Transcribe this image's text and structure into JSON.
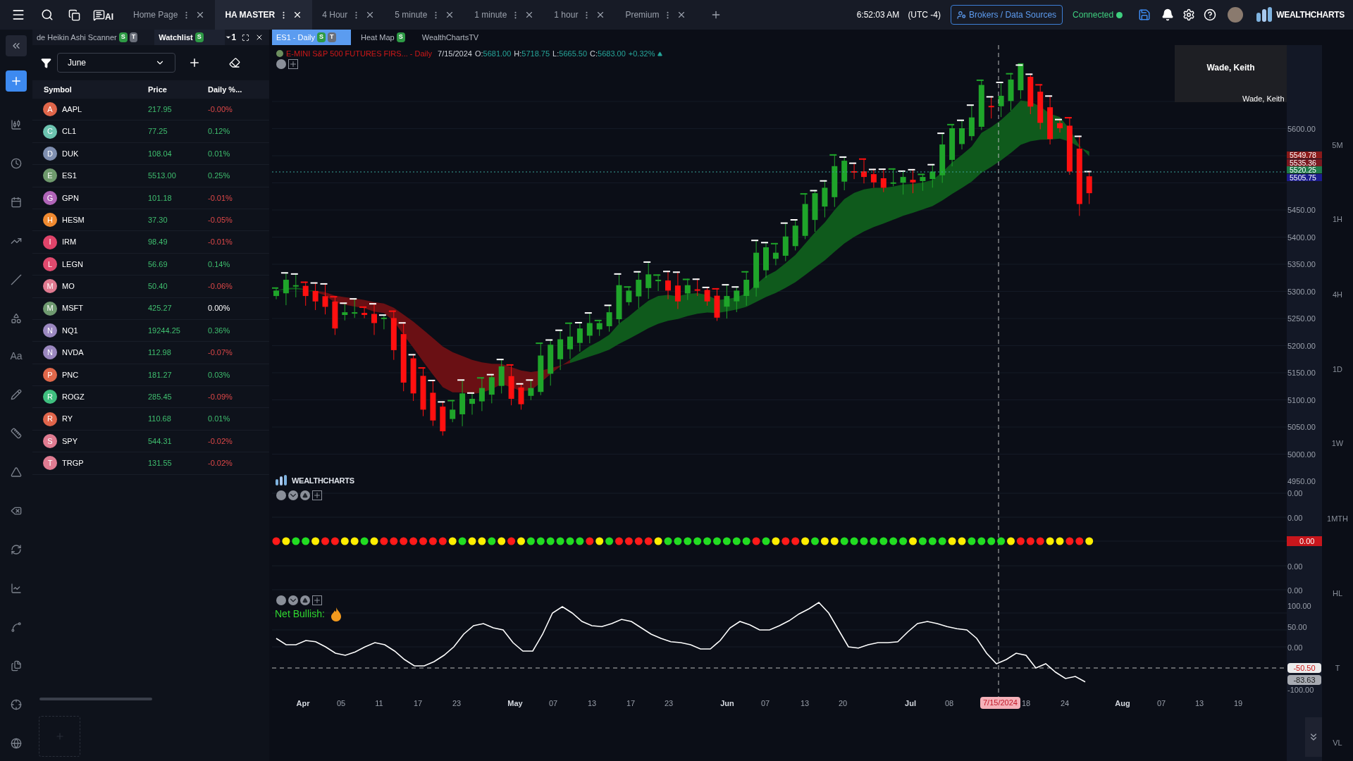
{
  "top_bar": {
    "ai_label": "AI",
    "tabs": [
      {
        "label": "Home Page",
        "selected": false
      },
      {
        "label": "HA MASTER",
        "selected": true
      },
      {
        "label": "4 Hour",
        "selected": false
      },
      {
        "label": "5 minute",
        "selected": false
      },
      {
        "label": "1 minute",
        "selected": false
      },
      {
        "label": "1 hour",
        "selected": false
      },
      {
        "label": "Premium",
        "selected": false
      }
    ],
    "clock": "6:52:03 AM",
    "timezone": "(UTC -4)",
    "brokers_button": "Brokers / Data Sources",
    "connection": {
      "label": "Connected",
      "on": true
    },
    "logo": "WEALTHCHARTS"
  },
  "left_rail": {
    "text_tool": "Aa"
  },
  "left_panel": {
    "tabs": [
      {
        "label": "de Heikin Ashi Scanner",
        "badges": [
          "S",
          "T"
        ],
        "selected": false
      },
      {
        "label": "Watchlist",
        "badges": [
          "S"
        ],
        "selected": true
      }
    ],
    "layout_count": "1",
    "filter_select": "June",
    "table": {
      "columns": [
        "Symbol",
        "Price",
        "Daily %..."
      ],
      "rows": [
        {
          "letter": "A",
          "color": "#e0664a",
          "symbol": "AAPL",
          "price": "217.95",
          "change": "-0.00%",
          "kind": "down"
        },
        {
          "letter": "C",
          "color": "#6cc3b0",
          "symbol": "CL1",
          "price": "77.25",
          "change": "0.12%",
          "kind": "up"
        },
        {
          "letter": "D",
          "color": "#7f8fb0",
          "symbol": "DUK",
          "price": "108.04",
          "change": "0.01%",
          "kind": "up"
        },
        {
          "letter": "E",
          "color": "#6f9a6d",
          "symbol": "ES1",
          "price": "5513.00",
          "change": "0.25%",
          "kind": "up"
        },
        {
          "letter": "G",
          "color": "#b064b8",
          "symbol": "GPN",
          "price": "101.18",
          "change": "-0.01%",
          "kind": "down"
        },
        {
          "letter": "H",
          "color": "#f08a30",
          "symbol": "HESM",
          "price": "37.30",
          "change": "-0.05%",
          "kind": "down"
        },
        {
          "letter": "I",
          "color": "#e0446a",
          "symbol": "IRM",
          "price": "98.49",
          "change": "-0.01%",
          "kind": "down"
        },
        {
          "letter": "L",
          "color": "#e04a6e",
          "symbol": "LEGN",
          "price": "56.69",
          "change": "0.14%",
          "kind": "up"
        },
        {
          "letter": "M",
          "color": "#e07a90",
          "symbol": "MO",
          "price": "50.40",
          "change": "-0.06%",
          "kind": "down"
        },
        {
          "letter": "M",
          "color": "#6f9a70",
          "symbol": "MSFT",
          "price": "425.27",
          "change": "0.00%",
          "kind": "flat"
        },
        {
          "letter": "N",
          "color": "#9b88c0",
          "symbol": "NQ1",
          "price": "19244.25",
          "change": "0.36%",
          "kind": "up"
        },
        {
          "letter": "N",
          "color": "#9a87bf",
          "symbol": "NVDA",
          "price": "112.98",
          "change": "-0.07%",
          "kind": "down"
        },
        {
          "letter": "P",
          "color": "#e0684a",
          "symbol": "PNC",
          "price": "181.27",
          "change": "0.03%",
          "kind": "up"
        },
        {
          "letter": "R",
          "color": "#3fbf7f",
          "symbol": "ROGZ",
          "price": "285.45",
          "change": "-0.09%",
          "kind": "down"
        },
        {
          "letter": "R",
          "color": "#e0654b",
          "symbol": "RY",
          "price": "110.68",
          "change": "0.01%",
          "kind": "up"
        },
        {
          "letter": "S",
          "color": "#e07b91",
          "symbol": "SPY",
          "price": "544.31",
          "change": "-0.02%",
          "kind": "down"
        },
        {
          "letter": "T",
          "color": "#e07c92",
          "symbol": "TRGP",
          "price": "131.55",
          "change": "-0.02%",
          "kind": "down"
        }
      ]
    }
  },
  "chart": {
    "tabs": [
      {
        "label": "ES1 - Daily",
        "badges": [
          "S",
          "T"
        ],
        "selected": true
      },
      {
        "label": "Heat Map",
        "badges": [
          "S"
        ],
        "selected": false
      },
      {
        "label": "WealthChartsTV",
        "selected": false
      }
    ],
    "legend": {
      "title": "E-MINI S&P 500 FUTURES FIRS... - Daily",
      "date": "7/15/2024",
      "open_label": "O:",
      "open": "5681.00",
      "high_label": "H:",
      "high": "5718.75",
      "low_label": "L:",
      "low": "5665.50",
      "close_label": "C:",
      "close": "5683.00",
      "change": "+0.32%"
    },
    "pane_logo": "WEALTHCHARTS",
    "price_axis": [
      "5600.00",
      "5450.00",
      "5400.00",
      "5350.00",
      "5300.00",
      "5250.00",
      "5200.00",
      "5150.00",
      "5100.00",
      "5050.00",
      "5000.00",
      "4950.00"
    ],
    "price_tags": [
      {
        "text": "5549.78",
        "color": "#8b1a1a"
      },
      {
        "text": "5535.36",
        "color": "#7a1820"
      },
      {
        "text": "5520.25",
        "color": "#1f7a4a"
      },
      {
        "text": "5505.75",
        "color": "#1c1c8c"
      }
    ],
    "signal_axis": [
      "0.00",
      "0.00",
      "0.00",
      "0.00"
    ],
    "signal_tag": "0.00",
    "signal_dots": [
      {
        "color": "#ff1a1a"
      },
      {
        "color": "#ffee00"
      },
      {
        "color": "#22dd22"
      },
      {
        "color": "#22dd22"
      },
      {
        "color": "#ffee00"
      },
      {
        "color": "#ff1a1a"
      },
      {
        "color": "#ff1a1a"
      },
      {
        "color": "#ffee00"
      },
      {
        "color": "#ffee00"
      },
      {
        "color": "#22dd22"
      },
      {
        "color": "#ffee00"
      },
      {
        "color": "#ff1a1a"
      },
      {
        "color": "#ff1a1a"
      },
      {
        "color": "#ff1a1a"
      },
      {
        "color": "#ff1a1a"
      },
      {
        "color": "#ff1a1a"
      },
      {
        "color": "#ff1a1a"
      },
      {
        "color": "#ff1a1a"
      },
      {
        "color": "#ffee00"
      },
      {
        "color": "#22dd22"
      },
      {
        "color": "#ffee00"
      },
      {
        "color": "#ffee00"
      },
      {
        "color": "#22dd22"
      },
      {
        "color": "#ffee00"
      },
      {
        "color": "#ff1a1a"
      },
      {
        "color": "#ffee00"
      },
      {
        "color": "#22dd22"
      },
      {
        "color": "#22dd22"
      },
      {
        "color": "#22dd22"
      },
      {
        "color": "#22dd22"
      },
      {
        "color": "#22dd22"
      },
      {
        "color": "#22dd22"
      },
      {
        "color": "#ff1a1a"
      },
      {
        "color": "#ffee00"
      },
      {
        "color": "#22dd22"
      },
      {
        "color": "#ff1a1a"
      },
      {
        "color": "#ff1a1a"
      },
      {
        "color": "#ff1a1a"
      },
      {
        "color": "#ff1a1a"
      },
      {
        "color": "#ffee00"
      },
      {
        "color": "#22dd22"
      },
      {
        "color": "#22dd22"
      },
      {
        "color": "#22dd22"
      },
      {
        "color": "#22dd22"
      },
      {
        "color": "#22dd22"
      },
      {
        "color": "#22dd22"
      },
      {
        "color": "#22dd22"
      },
      {
        "color": "#22dd22"
      },
      {
        "color": "#22dd22"
      },
      {
        "color": "#ff1a1a"
      },
      {
        "color": "#22dd22"
      },
      {
        "color": "#ffee00"
      },
      {
        "color": "#ff1a1a"
      },
      {
        "color": "#ff1a1a"
      },
      {
        "color": "#ffee00"
      },
      {
        "color": "#22dd22"
      },
      {
        "color": "#ffee00"
      },
      {
        "color": "#ffee00"
      },
      {
        "color": "#22dd22"
      },
      {
        "color": "#22dd22"
      },
      {
        "color": "#22dd22"
      },
      {
        "color": "#22dd22"
      },
      {
        "color": "#22dd22"
      },
      {
        "color": "#22dd22"
      },
      {
        "color": "#22dd22"
      },
      {
        "color": "#ffee00"
      },
      {
        "color": "#22dd22"
      },
      {
        "color": "#22dd22"
      },
      {
        "color": "#22dd22"
      },
      {
        "color": "#ffee00"
      },
      {
        "color": "#ffee00"
      },
      {
        "color": "#22dd22"
      },
      {
        "color": "#22dd22"
      },
      {
        "color": "#22dd22"
      },
      {
        "color": "#22dd22"
      },
      {
        "color": "#ffee00"
      },
      {
        "color": "#ff1a1a"
      },
      {
        "color": "#ff1a1a"
      },
      {
        "color": "#ff1a1a"
      },
      {
        "color": "#ffee00"
      },
      {
        "color": "#ffee00"
      },
      {
        "color": "#ff1a1a"
      },
      {
        "color": "#ff1a1a"
      },
      {
        "color": "#ffee00"
      }
    ],
    "oscillator": {
      "label": "Net Bullish:",
      "axis": [
        "100.00",
        "50.00",
        "0.00",
        "-100.00"
      ],
      "tags": [
        {
          "text": "-50.50",
          "kind": "cursor"
        },
        {
          "text": "-83.63",
          "kind": "last"
        }
      ]
    },
    "time_axis": [
      "Apr",
      "05",
      "11",
      "17",
      "23",
      "May",
      "07",
      "13",
      "17",
      "23",
      "Jun",
      "07",
      "13",
      "20",
      "Jul",
      "08",
      "18",
      "24",
      "Aug",
      "07",
      "13",
      "19"
    ],
    "crosshair_date": "7/15/2024",
    "timeframes": [
      "5M",
      "1H",
      "4H",
      "1D",
      "1W",
      "1MTH",
      "HL",
      "T",
      "VL"
    ]
  },
  "user_popup": {
    "name": "Wade, Keith"
  },
  "user_label": "Wade, Keith"
}
